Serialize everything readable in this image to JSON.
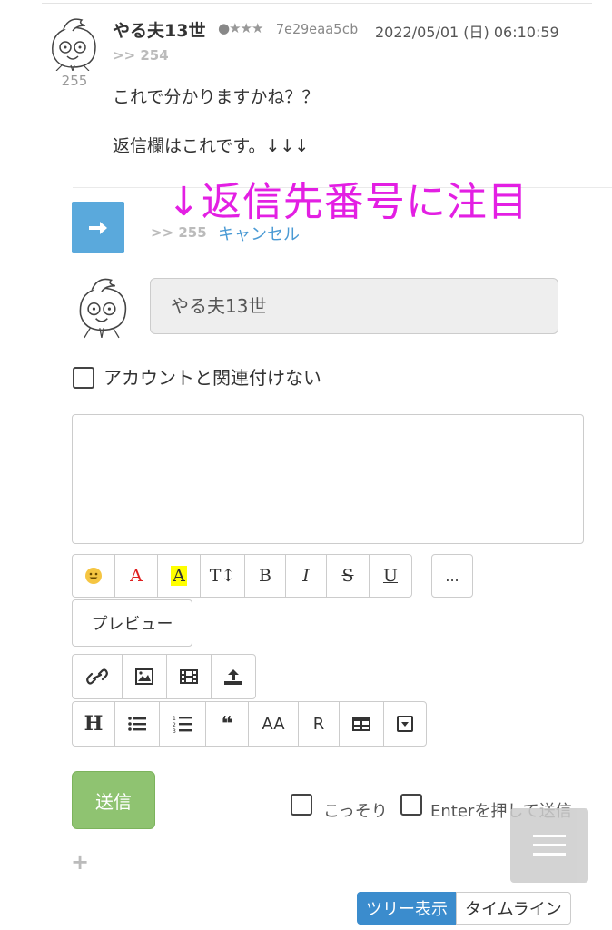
{
  "post": {
    "number": "255",
    "username": "やる夫13世",
    "rank_stars": "★★★",
    "user_id": "7e29eaa5cb",
    "datetime": "2022/05/01 (日) 06:10:59",
    "reply_to": ">> 254",
    "lines": [
      "これで分かりますかね？？",
      "返信欄はこれです。↓↓↓"
    ]
  },
  "annotation": "↓返信先番号に注目",
  "reply_form": {
    "reply_target": ">> 255",
    "cancel_label": "キャンセル",
    "name_value": "やる夫13世",
    "no_link_account_label": "アカウントと関連付けない",
    "body_value": "",
    "toolbar_row1": [
      {
        "name": "emoji-icon",
        "glyph": "😄"
      },
      {
        "name": "text-color-icon",
        "glyph": "A",
        "color": "#e02020"
      },
      {
        "name": "highlight-icon",
        "glyph": "A",
        "bg": "#ffff00"
      },
      {
        "name": "font-size-icon",
        "glyph": "T↕"
      },
      {
        "name": "bold-icon",
        "glyph": "B"
      },
      {
        "name": "italic-icon",
        "glyph": "I"
      },
      {
        "name": "strikethrough-icon",
        "glyph": "S"
      },
      {
        "name": "underline-icon",
        "glyph": "U"
      }
    ],
    "more_label": "...",
    "preview_label": "プレビュー",
    "toolbar_row3": [
      {
        "name": "link-icon"
      },
      {
        "name": "image-icon"
      },
      {
        "name": "video-icon"
      },
      {
        "name": "upload-icon"
      }
    ],
    "toolbar_row4": [
      {
        "name": "heading-icon",
        "glyph": "H"
      },
      {
        "name": "bullet-list-icon"
      },
      {
        "name": "numbered-list-icon"
      },
      {
        "name": "quote-icon",
        "glyph": "❝"
      },
      {
        "name": "aa-icon",
        "glyph": "AA"
      },
      {
        "name": "r-icon",
        "glyph": "R"
      },
      {
        "name": "table-icon"
      },
      {
        "name": "collapse-icon"
      }
    ],
    "send_label": "送信",
    "kossori_label": "こっそり",
    "enter_send_label": "Enterを押して送信"
  },
  "plus_label": "+",
  "view_tabs": [
    "ツリー表示",
    "タイムライン"
  ],
  "colors": {
    "accent": "#5aa9dc",
    "annotation": "#e31fe3",
    "send": "#8fc371",
    "tab_active": "#3b8ccd"
  }
}
